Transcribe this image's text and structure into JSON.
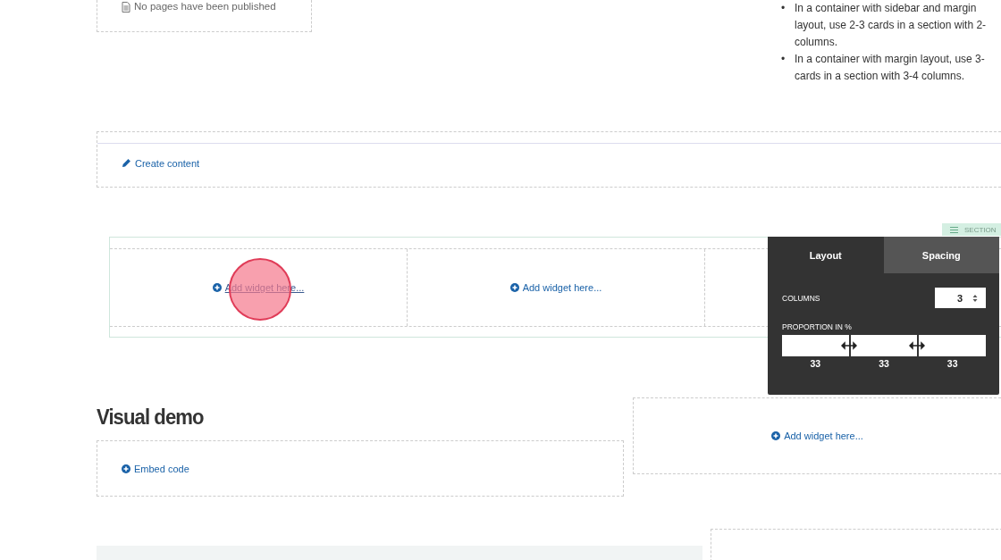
{
  "published_box": {
    "text": "No pages have been published"
  },
  "guidelines": [
    {
      "bullet": "•",
      "text": "In a container with sidebar and margin layout, use 2-3 cards in a section with 2-columns."
    },
    {
      "bullet": "•",
      "text": "In a container with margin layout, use 3-cards in a section with 3-4 columns."
    }
  ],
  "create_content": {
    "label": "Create content"
  },
  "section": {
    "tag": "SECTION",
    "columns": [
      {
        "label": "Add widget here...",
        "hovered": true
      },
      {
        "label": "Add widget here...",
        "hovered": false
      }
    ]
  },
  "settings_panel": {
    "tabs": [
      {
        "label": "Layout",
        "selected": true
      },
      {
        "label": "Spacing",
        "selected": false
      }
    ],
    "columns_label": "COLUMNS",
    "columns_value": "3",
    "proportion_label": "PROPORTION IN %",
    "proportions": [
      "33",
      "33",
      "33"
    ]
  },
  "visual_demo": {
    "heading": "Visual demo",
    "embed_label": "Embed code"
  },
  "side_widget": {
    "label": "Add widget here..."
  }
}
